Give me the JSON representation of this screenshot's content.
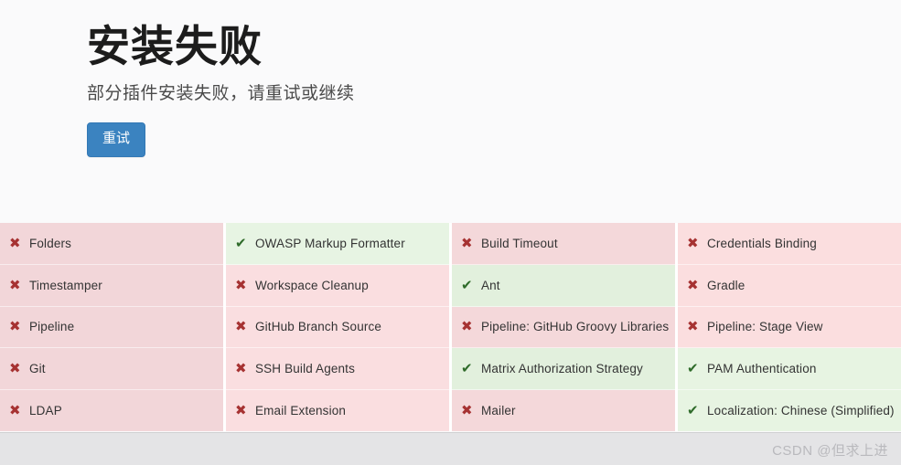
{
  "header": {
    "title": "安装失败",
    "subtitle": "部分插件安装失败，请重试或继续",
    "retry_label": "重试",
    "accent_color": "#3b83c0"
  },
  "status": {
    "failed_icon": "✖",
    "success_icon": "✔",
    "failed_color": "#a63232",
    "success_color": "#2f6b2a",
    "failed_bg": "#f6d9db",
    "success_bg": "#e4f2e0"
  },
  "grid": {
    "columns": [
      {
        "cells": [
          {
            "label": "Folders",
            "state": "failed"
          },
          {
            "label": "Timestamper",
            "state": "failed"
          },
          {
            "label": "Pipeline",
            "state": "failed"
          },
          {
            "label": "Git",
            "state": "failed"
          },
          {
            "label": "LDAP",
            "state": "failed"
          }
        ]
      },
      {
        "cells": [
          {
            "label": "OWASP Markup Formatter",
            "state": "success"
          },
          {
            "label": "Workspace Cleanup",
            "state": "failed"
          },
          {
            "label": "GitHub Branch Source",
            "state": "failed"
          },
          {
            "label": "SSH Build Agents",
            "state": "failed"
          },
          {
            "label": "Email Extension",
            "state": "failed"
          }
        ]
      },
      {
        "cells": [
          {
            "label": "Build Timeout",
            "state": "failed"
          },
          {
            "label": "Ant",
            "state": "success"
          },
          {
            "label": "Pipeline: GitHub Groovy Libraries",
            "state": "failed"
          },
          {
            "label": "Matrix Authorization Strategy",
            "state": "success"
          },
          {
            "label": "Mailer",
            "state": "failed"
          }
        ]
      },
      {
        "cells": [
          {
            "label": "Credentials Binding",
            "state": "failed"
          },
          {
            "label": "Gradle",
            "state": "failed"
          },
          {
            "label": "Pipeline: Stage View",
            "state": "failed"
          },
          {
            "label": "PAM Authentication",
            "state": "success"
          },
          {
            "label": "Localization: Chinese (Simplified)",
            "state": "success"
          }
        ]
      }
    ]
  },
  "footer": {
    "watermark": "CSDN @但求上进"
  }
}
